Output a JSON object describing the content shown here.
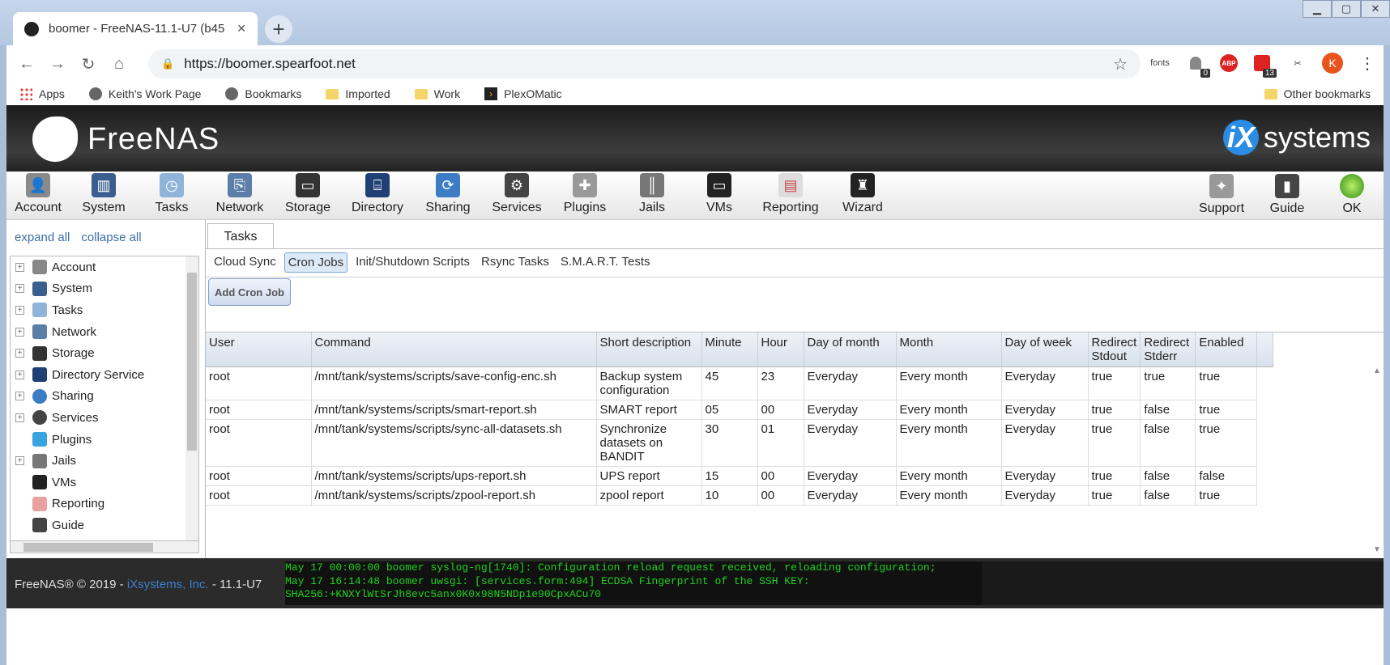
{
  "browser": {
    "tab_title": "boomer - FreeNAS-11.1-U7 (b45",
    "tab_close": "✕",
    "new_tab": "+",
    "win_min": "▁",
    "win_max": "▢",
    "win_close": "✕",
    "back": "←",
    "forward": "→",
    "reload": "↻",
    "home": "⌂",
    "lock": "🔒",
    "url": "https://boomer.spearfoot.net",
    "star": "☆",
    "ext_fonts": "fonts",
    "ext_ghost_badge": "0",
    "ext_abp": "ABP",
    "ext_cal_badge": "13",
    "avatar": "K",
    "menu": "⋮"
  },
  "bookmarks": {
    "items": [
      "Apps",
      "Keith's Work Page",
      "Bookmarks",
      "Imported",
      "Work",
      "PlexOMatic"
    ],
    "other": "Other bookmarks"
  },
  "app": {
    "logo_text": "FreeNAS",
    "vendor_text": "systems",
    "vendor_mark": "iX"
  },
  "menubar": {
    "items": [
      "Account",
      "System",
      "Tasks",
      "Network",
      "Storage",
      "Directory",
      "Sharing",
      "Services",
      "Plugins",
      "Jails",
      "VMs",
      "Reporting",
      "Wizard"
    ],
    "right": [
      "Support",
      "Guide",
      "OK"
    ]
  },
  "sidebar": {
    "expand_all": "expand all",
    "collapse_all": "collapse all",
    "items": [
      "Account",
      "System",
      "Tasks",
      "Network",
      "Storage",
      "Directory Service",
      "Sharing",
      "Services",
      "Plugins",
      "Jails",
      "VMs",
      "Reporting",
      "Guide"
    ]
  },
  "content": {
    "tab": "Tasks",
    "subtabs": [
      "Cloud Sync",
      "Cron Jobs",
      "Init/Shutdown Scripts",
      "Rsync Tasks",
      "S.M.A.R.T. Tests"
    ],
    "add_button": "Add Cron Job",
    "columns": [
      "User",
      "Command",
      "Short description",
      "Minute",
      "Hour",
      "Day of month",
      "Month",
      "Day of week",
      "Redirect Stdout",
      "Redirect Stderr",
      "Enabled"
    ],
    "rows": [
      [
        "root",
        "/mnt/tank/systems/scripts/save-config-enc.sh",
        "Backup system configuration",
        "45",
        "23",
        "Everyday",
        "Every month",
        "Everyday",
        "true",
        "true",
        "true"
      ],
      [
        "root",
        "/mnt/tank/systems/scripts/smart-report.sh",
        "SMART report",
        "05",
        "00",
        "Everyday",
        "Every month",
        "Everyday",
        "true",
        "false",
        "true"
      ],
      [
        "root",
        "/mnt/tank/systems/scripts/sync-all-datasets.sh",
        "Synchronize datasets on BANDIT",
        "30",
        "01",
        "Everyday",
        "Every month",
        "Everyday",
        "true",
        "false",
        "true"
      ],
      [
        "root",
        "/mnt/tank/systems/scripts/ups-report.sh",
        "UPS report",
        "15",
        "00",
        "Everyday",
        "Every month",
        "Everyday",
        "true",
        "false",
        "false"
      ],
      [
        "root",
        "/mnt/tank/systems/scripts/zpool-report.sh",
        "zpool report",
        "10",
        "00",
        "Everyday",
        "Every month",
        "Everyday",
        "true",
        "false",
        "true"
      ]
    ]
  },
  "footer": {
    "copyright": "FreeNAS® © 2019 - ",
    "vendor": "iXsystems, Inc.",
    "version": " - 11.1-U7",
    "console": [
      "May 17 00:00:00 boomer syslog-ng[1740]: Configuration reload request received, reloading configuration;",
      "May 17 16:14:48 boomer uwsgi: [services.form:494] ECDSA Fingerprint of the SSH KEY:",
      "SHA256:+KNXYlWtSrJh8evc5anx0K0x98N5NDp1e90CpxACu70"
    ]
  }
}
